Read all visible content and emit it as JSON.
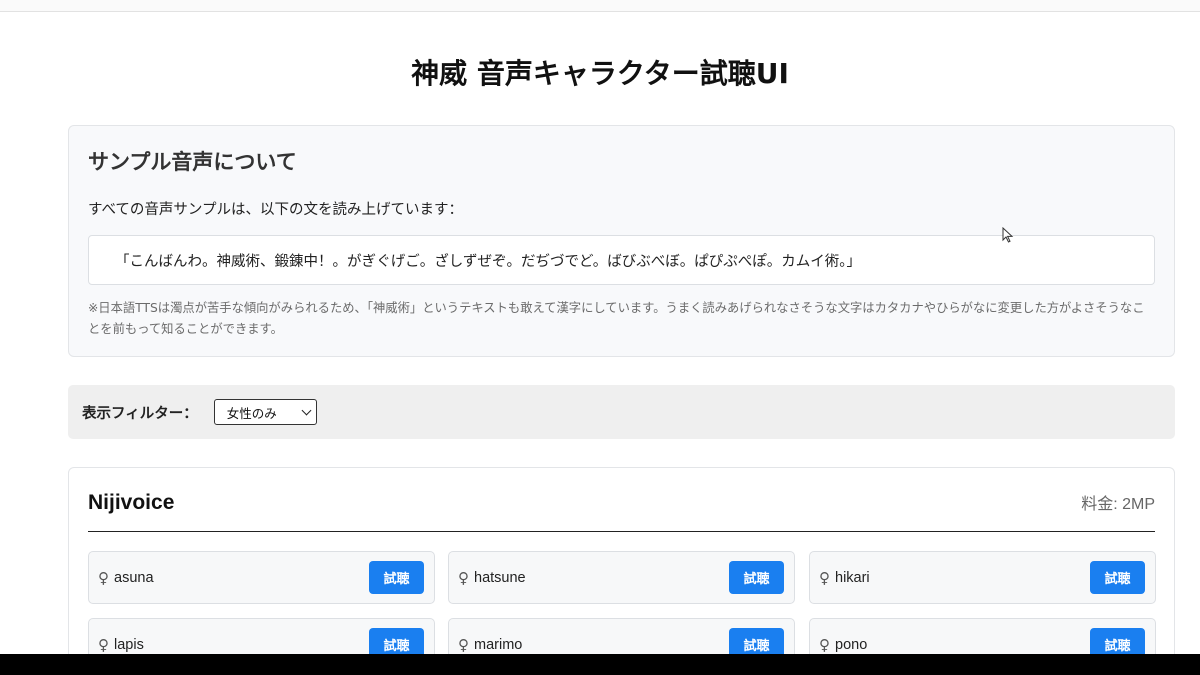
{
  "page": {
    "title": "神威 音声キャラクター試聴UI"
  },
  "about": {
    "title": "サンプル音声について",
    "description": "すべての音声サンプルは、以下の文を読み上げています：",
    "sample_text": "「こんばんわ。神威術、鍛錬中！。がぎぐげご。ざしずぜぞ。だぢづでど。ばびぶべぼ。ぱぴぷぺぽ。カムイ術。」",
    "note": "※日本語TTSは濁点が苦手な傾向がみられるため、「神威術」というテキストも敢えて漢字にしています。うまく読みあげられなさそうな文字はカタカナやひらがなに変更した方がよさそうなことを前もって知ることができます。"
  },
  "filter": {
    "label": "表示フィルター：",
    "selected": "女性のみ"
  },
  "provider": {
    "name": "Nijivoice",
    "price": "料金: 2MP",
    "play_label": "試聴",
    "gender_icon": "female-icon",
    "voices": [
      {
        "name": "asuna"
      },
      {
        "name": "hatsune"
      },
      {
        "name": "hikari"
      },
      {
        "name": "lapis"
      },
      {
        "name": "marimo"
      },
      {
        "name": "pono"
      }
    ]
  },
  "colors": {
    "accent": "#1a7ff0"
  }
}
